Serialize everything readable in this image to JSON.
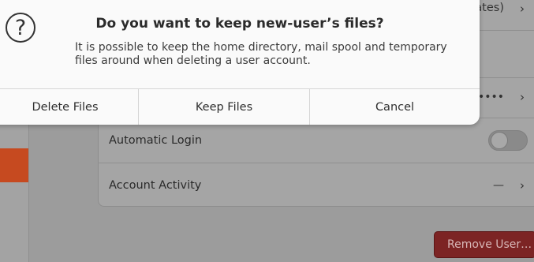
{
  "background": {
    "partial_top_right_text": "ates)",
    "password_value": "•••••",
    "automatic_login_label": "Automatic Login",
    "account_activity_label": "Account Activity",
    "account_activity_value": "—",
    "remove_user_label": "Remove User…",
    "chevron_glyph": "›"
  },
  "dialog": {
    "icon": "question-circle-icon",
    "icon_glyph": "?",
    "title": "Do you want to keep new-user’s files?",
    "message": "It is possible to keep the home directory, mail spool and temporary files around when deleting a user account.",
    "buttons": {
      "delete": "Delete Files",
      "keep": "Keep Files",
      "cancel": "Cancel"
    }
  },
  "colors": {
    "accent": "#c64a20",
    "destructive": "#7c2424",
    "dialog_bg": "#fafafa",
    "dim_bg": "#9c9c9c"
  }
}
